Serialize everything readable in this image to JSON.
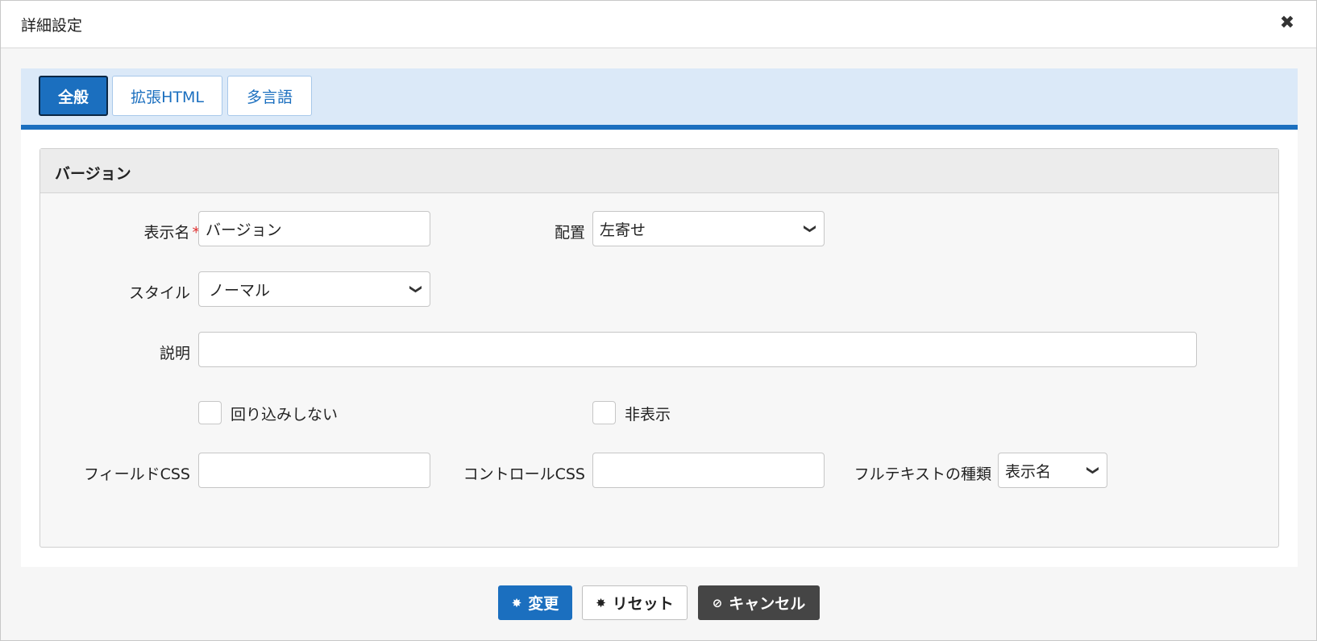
{
  "dialog": {
    "title": "詳細設定",
    "close_icon": "close-icon"
  },
  "tabs": [
    {
      "label": "全般",
      "active": true
    },
    {
      "label": "拡張HTML",
      "active": false
    },
    {
      "label": "多言語",
      "active": false
    }
  ],
  "section": {
    "title": "バージョン"
  },
  "form": {
    "display_name": {
      "label": "表示名",
      "required_mark": "*",
      "value": "バージョン"
    },
    "placement": {
      "label": "配置",
      "value": "左寄せ"
    },
    "style": {
      "label": "スタイル",
      "value": "ノーマル"
    },
    "description": {
      "label": "説明",
      "value": ""
    },
    "no_wrap": {
      "label": "回り込みしない",
      "checked": false
    },
    "hidden": {
      "label": "非表示",
      "checked": false
    },
    "field_css": {
      "label": "フィールドCSS",
      "value": ""
    },
    "control_css": {
      "label": "コントロールCSS",
      "value": ""
    },
    "fulltext_type": {
      "label": "フルテキストの種類",
      "value": "表示名"
    }
  },
  "buttons": {
    "change": {
      "label": "変更",
      "icon": "gear-icon"
    },
    "reset": {
      "label": "リセット",
      "icon": "gear-icon"
    },
    "cancel": {
      "label": "キャンセル",
      "icon": "ban-icon"
    }
  },
  "colors": {
    "accent": "#1b6fbf",
    "tabbar_bg": "#dbe9f8",
    "required": "#e03030",
    "dark_button": "#454545"
  }
}
